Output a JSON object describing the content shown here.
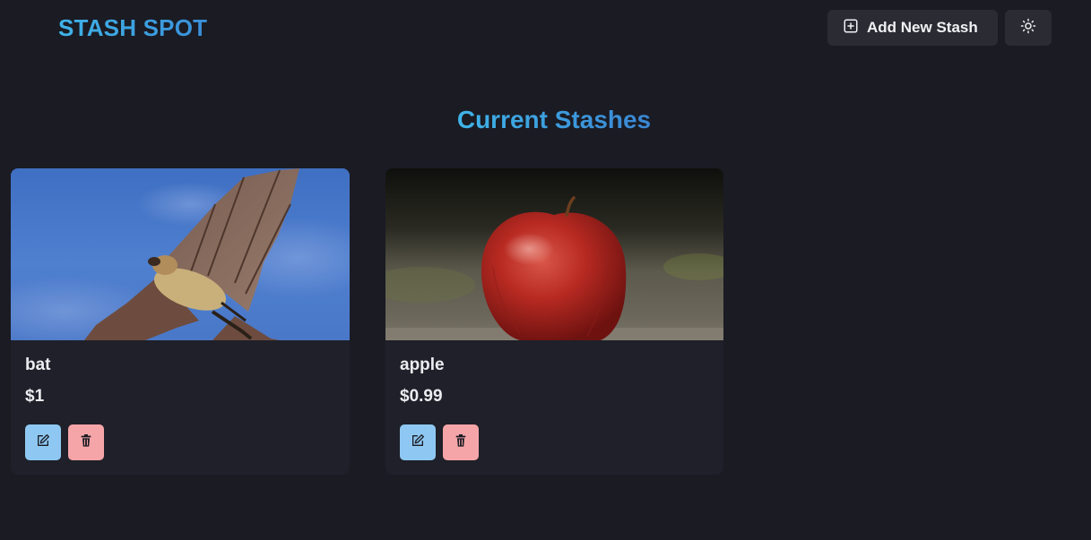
{
  "header": {
    "logo": "STASH SPOT",
    "add_button_label": "Add New Stash",
    "add_icon": "plus-square-icon",
    "theme_icon": "sun-icon"
  },
  "main": {
    "title": "Current Stashes",
    "stashes": [
      {
        "name": "bat",
        "price": "$1",
        "image": "bat-photo"
      },
      {
        "name": "apple",
        "price": "$0.99",
        "image": "apple-photo"
      }
    ]
  },
  "colors": {
    "background": "#1a1b23",
    "card": "#1f2029",
    "accent": "#3a9ad9",
    "edit": "#8ec8f2",
    "delete": "#f5a5a8"
  }
}
